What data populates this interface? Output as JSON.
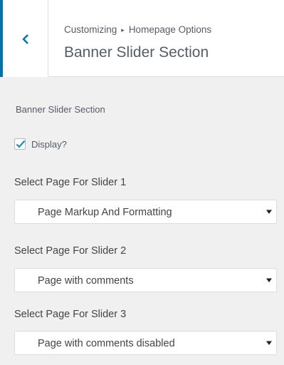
{
  "header": {
    "breadcrumb_parent": "Customizing",
    "breadcrumb_separator": "▸",
    "breadcrumb_current": "Homepage Options",
    "title": "Banner Slider Section"
  },
  "section": {
    "title": "Banner Slider Section",
    "display_checkbox": {
      "label": "Display?",
      "checked": true
    }
  },
  "fields": [
    {
      "label": "Select Page For Slider 1",
      "selected": "Page Markup And Formatting"
    },
    {
      "label": "Select Page For Slider 2",
      "selected": "Page with comments"
    },
    {
      "label": "Select Page For Slider 3",
      "selected": "Page with comments disabled"
    }
  ],
  "colors": {
    "accent": "#0073aa",
    "checkmark": "#1e8cbe"
  },
  "icons": {
    "back": "chevron-left-icon",
    "dropdown": "caret-down-icon",
    "check": "checkmark-icon"
  }
}
